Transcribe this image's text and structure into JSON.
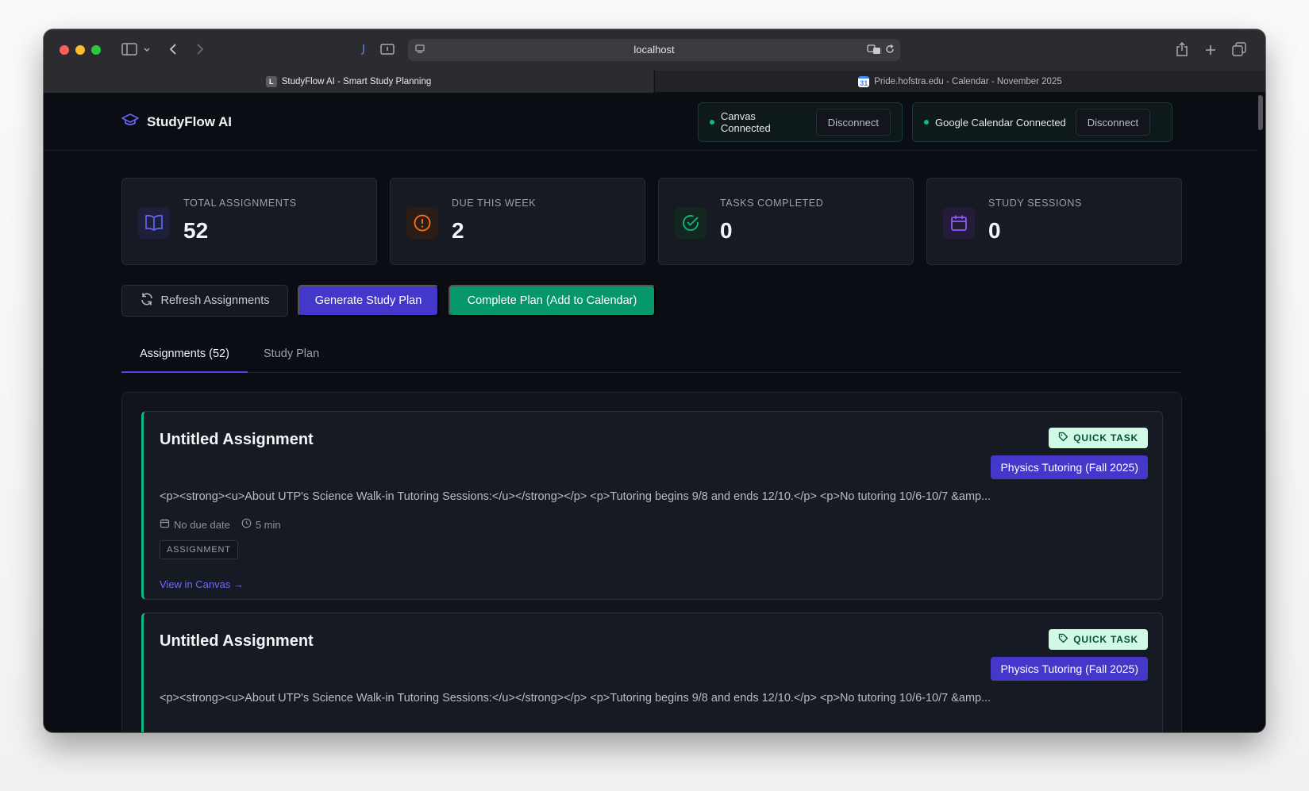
{
  "browser": {
    "url": "localhost",
    "tabs": [
      {
        "title": "StudyFlow AI - Smart Study Planning",
        "favicon_letter": "L"
      },
      {
        "title": "Pride.hofstra.edu - Calendar - November 2025",
        "favicon_letter": "31"
      }
    ]
  },
  "app": {
    "name": "StudyFlow AI",
    "connections": [
      {
        "label": "Canvas Connected",
        "action": "Disconnect"
      },
      {
        "label": "Google Calendar Connected",
        "action": "Disconnect"
      }
    ]
  },
  "stats": [
    {
      "label": "TOTAL ASSIGNMENTS",
      "value": "52",
      "icon": "book-icon",
      "color": "#6366f1"
    },
    {
      "label": "DUE THIS WEEK",
      "value": "2",
      "icon": "alert-circle-icon",
      "color": "#f97316"
    },
    {
      "label": "TASKS COMPLETED",
      "value": "0",
      "icon": "check-circle-icon",
      "color": "#10b981"
    },
    {
      "label": "STUDY SESSIONS",
      "value": "0",
      "icon": "calendar-icon",
      "color": "#8b5cf6"
    }
  ],
  "actions": {
    "refresh": "Refresh Assignments",
    "generate": "Generate Study Plan",
    "complete": "Complete Plan (Add to Calendar)"
  },
  "tabs": [
    {
      "label": "Assignments (52)",
      "active": true
    },
    {
      "label": "Study Plan",
      "active": false
    }
  ],
  "assignments": [
    {
      "title": "Untitled Assignment",
      "badge": "QUICK TASK",
      "course": "Physics Tutoring (Fall 2025)",
      "description": "<p><strong><u>About UTP's Science Walk-in Tutoring Sessions:</u></strong></p> <p>Tutoring begins 9/8 and ends 12/10.</p> <p>No tutoring 10/6-10/7 &amp...",
      "due": "No due date",
      "duration": "5 min",
      "type": "ASSIGNMENT",
      "link": "View in Canvas →"
    },
    {
      "title": "Untitled Assignment",
      "badge": "QUICK TASK",
      "course": "Physics Tutoring (Fall 2025)",
      "description": "<p><strong><u>About UTP's Science Walk-in Tutoring Sessions:</u></strong></p> <p>Tutoring begins 9/8 and ends 12/10.</p> <p>No tutoring 10/6-10/7 &amp..."
    }
  ],
  "colors": {
    "accent": "#4338ca",
    "success": "#059669",
    "background": "#0b0d14"
  }
}
